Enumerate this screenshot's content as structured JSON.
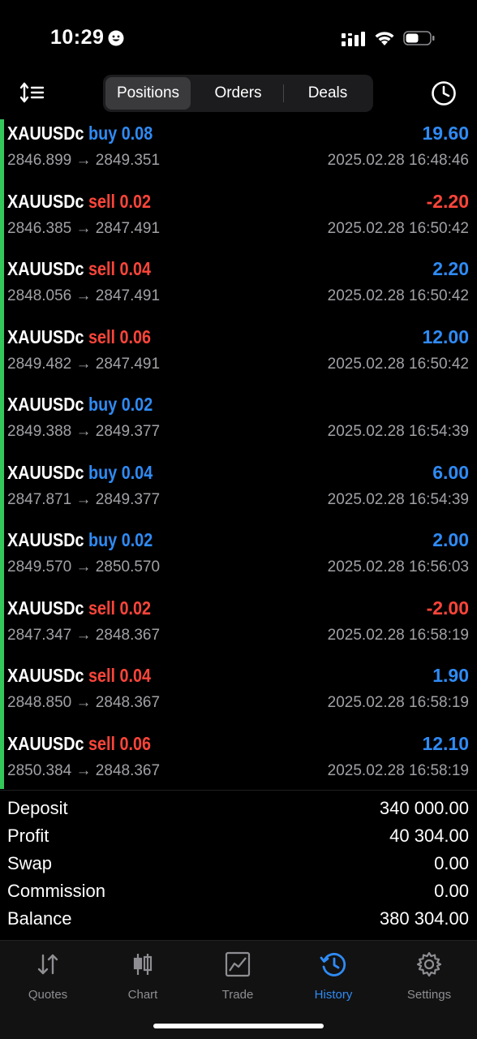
{
  "status_bar": {
    "time": "10:29"
  },
  "toolbar": {
    "segments": [
      {
        "label": "Positions",
        "active": true
      },
      {
        "label": "Orders",
        "active": false
      },
      {
        "label": "Deals",
        "active": false
      }
    ]
  },
  "colors": {
    "buy": "#2f8bf5",
    "sell": "#ff453a",
    "accent": "#34c759",
    "muted": "#a1a1a6"
  },
  "deals": [
    {
      "symbol": "XAUUSDc",
      "side": "buy",
      "volume": "0.08",
      "prices": "2846.899 → 2849.351",
      "profit": "19.60",
      "time": "2025.02.28 16:48:46"
    },
    {
      "symbol": "XAUUSDc",
      "side": "sell",
      "volume": "0.02",
      "prices": "2846.385 → 2847.491",
      "profit": "-2.20",
      "time": "2025.02.28 16:50:42"
    },
    {
      "symbol": "XAUUSDc",
      "side": "sell",
      "volume": "0.04",
      "prices": "2848.056 → 2847.491",
      "profit": "2.20",
      "time": "2025.02.28 16:50:42"
    },
    {
      "symbol": "XAUUSDc",
      "side": "sell",
      "volume": "0.06",
      "prices": "2849.482 → 2847.491",
      "profit": "12.00",
      "time": "2025.02.28 16:50:42"
    },
    {
      "symbol": "XAUUSDc",
      "side": "buy",
      "volume": "0.02",
      "prices": "2849.388 → 2849.377",
      "profit": "",
      "time": "2025.02.28 16:54:39"
    },
    {
      "symbol": "XAUUSDc",
      "side": "buy",
      "volume": "0.04",
      "prices": "2847.871 → 2849.377",
      "profit": "6.00",
      "time": "2025.02.28 16:54:39"
    },
    {
      "symbol": "XAUUSDc",
      "side": "buy",
      "volume": "0.02",
      "prices": "2849.570 → 2850.570",
      "profit": "2.00",
      "time": "2025.02.28 16:56:03"
    },
    {
      "symbol": "XAUUSDc",
      "side": "sell",
      "volume": "0.02",
      "prices": "2847.347 → 2848.367",
      "profit": "-2.00",
      "time": "2025.02.28 16:58:19"
    },
    {
      "symbol": "XAUUSDc",
      "side": "sell",
      "volume": "0.04",
      "prices": "2848.850 → 2848.367",
      "profit": "1.90",
      "time": "2025.02.28 16:58:19"
    },
    {
      "symbol": "XAUUSDc",
      "side": "sell",
      "volume": "0.06",
      "prices": "2850.384 → 2848.367",
      "profit": "12.10",
      "time": "2025.02.28 16:58:19"
    }
  ],
  "summary": [
    {
      "label": "Deposit",
      "value": "340 000.00"
    },
    {
      "label": "Profit",
      "value": "40 304.00"
    },
    {
      "label": "Swap",
      "value": "0.00"
    },
    {
      "label": "Commission",
      "value": "0.00"
    },
    {
      "label": "Balance",
      "value": "380 304.00"
    }
  ],
  "tabs": [
    {
      "label": "Quotes",
      "icon": "quotes-icon",
      "active": false
    },
    {
      "label": "Chart",
      "icon": "chart-icon",
      "active": false
    },
    {
      "label": "Trade",
      "icon": "trade-icon",
      "active": false
    },
    {
      "label": "History",
      "icon": "history-icon",
      "active": true
    },
    {
      "label": "Settings",
      "icon": "settings-icon",
      "active": false
    }
  ]
}
